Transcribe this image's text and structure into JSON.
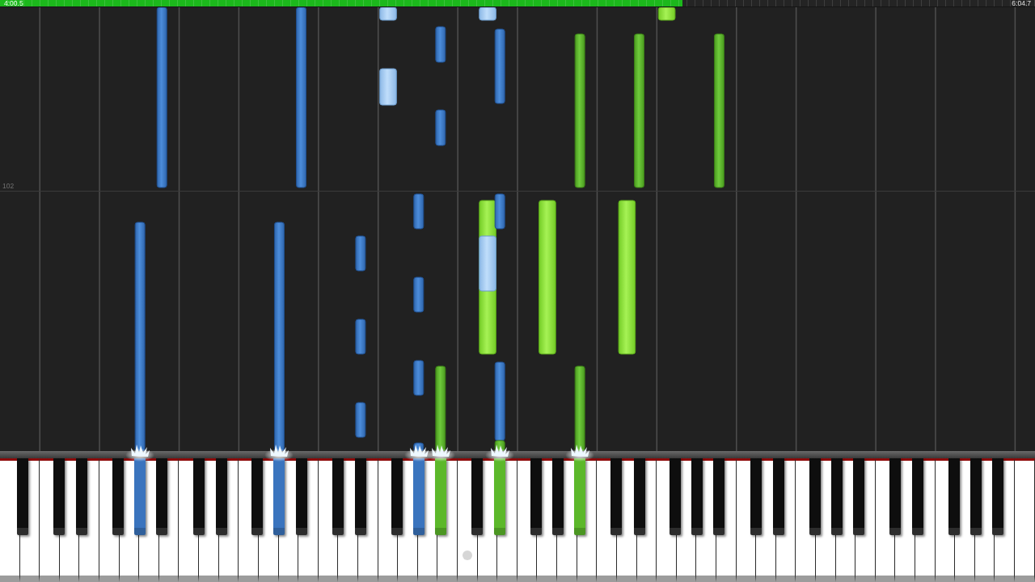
{
  "progress": {
    "elapsed": "4:00.5",
    "total": "6:04.7",
    "level": 0.659
  },
  "measure": {
    "label": "102"
  },
  "keyboard": {
    "keys": [
      {
        "pressed": false
      },
      {
        "pressed": false
      },
      {
        "pressed": false
      },
      {
        "pressed": false
      },
      {
        "pressed": false
      },
      {
        "pressed": false
      },
      {
        "pressed": false
      },
      {
        "pressed": false
      },
      {
        "pressed": false
      },
      {
        "pressed": false
      },
      {
        "pressed": false
      },
      {
        "pressed": true,
        "color": "#3a74be"
      },
      {
        "pressed": false
      },
      {
        "pressed": false
      },
      {
        "pressed": false
      },
      {
        "pressed": false
      },
      {
        "pressed": false
      },
      {
        "pressed": false
      },
      {
        "pressed": false
      },
      {
        "pressed": false
      },
      {
        "pressed": false
      },
      {
        "pressed": false
      },
      {
        "pressed": false
      },
      {
        "pressed": true,
        "color": "#3a74be"
      },
      {
        "pressed": false
      },
      {
        "pressed": false
      },
      {
        "pressed": false
      },
      {
        "pressed": false
      },
      {
        "pressed": false
      },
      {
        "pressed": false
      },
      {
        "pressed": false
      },
      {
        "pressed": false
      },
      {
        "pressed": false
      },
      {
        "pressed": false
      },
      {
        "pressed": false
      },
      {
        "pressed": true,
        "color": "#3a74be"
      },
      {
        "pressed": false
      },
      {
        "pressed": true,
        "color": "#5cb82a"
      },
      {
        "pressed": false
      },
      {
        "pressed": false
      },
      {
        "pressed": false
      },
      {
        "pressed": false
      },
      {
        "pressed": true,
        "color": "#5cb82a"
      },
      {
        "pressed": false
      },
      {
        "pressed": false
      },
      {
        "pressed": false
      },
      {
        "pressed": false
      },
      {
        "pressed": false
      },
      {
        "pressed": false
      },
      {
        "pressed": true,
        "color": "#5cb82a"
      },
      {
        "pressed": false
      },
      {
        "pressed": false
      },
      {
        "pressed": false
      },
      {
        "pressed": false
      },
      {
        "pressed": false
      },
      {
        "pressed": false
      },
      {
        "pressed": false
      },
      {
        "pressed": false
      },
      {
        "pressed": false
      },
      {
        "pressed": false
      },
      {
        "pressed": false
      },
      {
        "pressed": false
      },
      {
        "pressed": false
      },
      {
        "pressed": false
      },
      {
        "pressed": false
      },
      {
        "pressed": false
      },
      {
        "pressed": false
      },
      {
        "pressed": false
      },
      {
        "pressed": false
      },
      {
        "pressed": false
      },
      {
        "pressed": false
      },
      {
        "pressed": false
      },
      {
        "pressed": false
      },
      {
        "pressed": false
      },
      {
        "pressed": false
      },
      {
        "pressed": false
      },
      {
        "pressed": false
      },
      {
        "pressed": false
      },
      {
        "pressed": false
      },
      {
        "pressed": false
      },
      {
        "pressed": false
      },
      {
        "pressed": false
      },
      {
        "pressed": false
      },
      {
        "pressed": false
      },
      {
        "pressed": false
      },
      {
        "pressed": false
      },
      {
        "pressed": false
      },
      {
        "pressed": false
      }
    ]
  }
}
